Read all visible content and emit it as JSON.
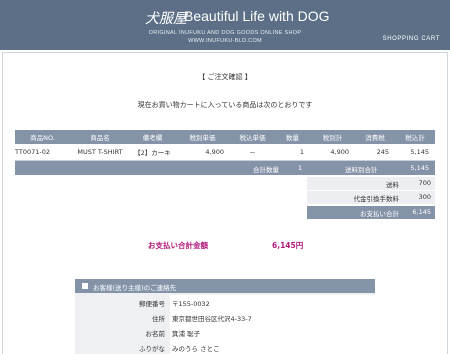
{
  "header": {
    "logo_jp": "犬服屋",
    "logo_en": "Beautiful Life with DOG",
    "subtitle": "ORIGINAL INUFUKU AND DOG GOODS ONLINE SHOP",
    "url": "WWW.INUFUKU-BLD.COM",
    "section": "SHOPPING CART",
    "bg_color": "#5c6f86"
  },
  "page": {
    "title": "【 ご注文確認 】",
    "lead": "現在お買い物カートに入っている商品は次のとおりです"
  },
  "cart": {
    "columns": [
      "商品NO.",
      "商品名",
      "備考欄",
      "税別単価",
      "税込単価",
      "数量",
      "税別計",
      "消費税",
      "税込計"
    ],
    "rows": [
      [
        "TT0071-02",
        "MUST T-SHIRT",
        "【2】カーキ",
        "4,900",
        "－",
        "1",
        "4,900",
        "245",
        "5,145"
      ]
    ],
    "total_label": "合計数量",
    "total_qty": "1",
    "subtotal_label": "送料別合計",
    "subtotal_value": "5,145"
  },
  "fees": [
    {
      "label": "送料",
      "value": "700"
    },
    {
      "label": "代金引換手数料",
      "value": "300"
    }
  ],
  "payment_total": {
    "label": "お支払い合計",
    "value": "6,145"
  },
  "grand_total": {
    "label": "お支払い合計金額",
    "value": "6,145円",
    "color": "#b0177a"
  },
  "contact": {
    "title": "お客様(送り主様)のご連絡先",
    "fields": [
      {
        "label": "郵便番号",
        "value": "〒155-0032"
      },
      {
        "label": "住所",
        "value": "東京都世田谷区代沢4-33-7"
      },
      {
        "label": "お名前",
        "value": "箕浦 聡子"
      },
      {
        "label": "ふりがな",
        "value": "みのうら さとこ"
      }
    ]
  }
}
